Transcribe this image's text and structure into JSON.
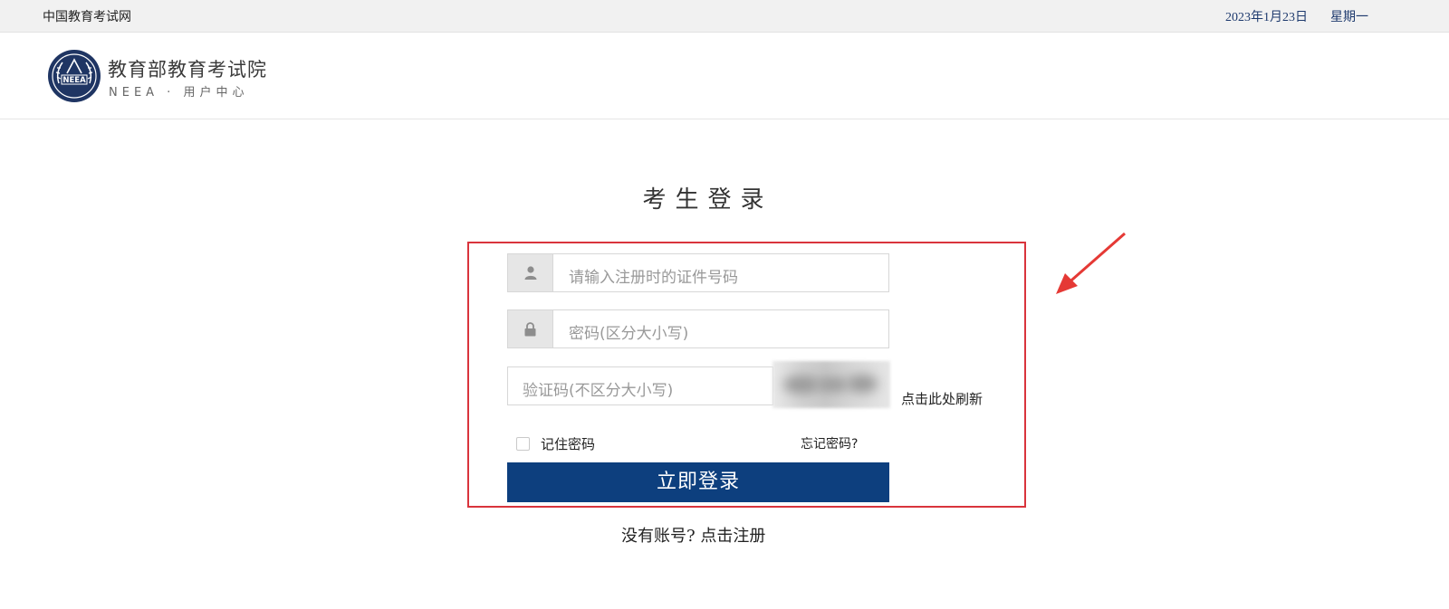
{
  "topbar": {
    "site_name": "中国教育考试网",
    "date": "2023年1月23日",
    "weekday": "星期一"
  },
  "header": {
    "logo_title": "教育部教育考试院",
    "logo_subtitle": "NEEA · 用户中心",
    "emblem_text": "NEEA"
  },
  "login": {
    "title": "考生登录",
    "id_placeholder": "请输入注册时的证件号码",
    "password_placeholder": "密码(区分大小写)",
    "captcha_placeholder": "验证码(不区分大小写)",
    "refresh_label": "点击此处刷新",
    "remember_label": "记住密码",
    "forgot_label": "忘记密码?",
    "submit_label": "立即登录",
    "no_account_text": "没有账号?",
    "register_label": "点击注册"
  },
  "icons": {
    "user": "user-icon",
    "lock": "lock-icon",
    "emblem": "neea-emblem-icon",
    "arrow": "annotation-arrow-icon"
  },
  "colors": {
    "primary_button": "#0d3f7e",
    "annotation_red": "#d9343c",
    "date_blue": "#1e3a6e",
    "topbar_bg": "#f1f1f1"
  }
}
